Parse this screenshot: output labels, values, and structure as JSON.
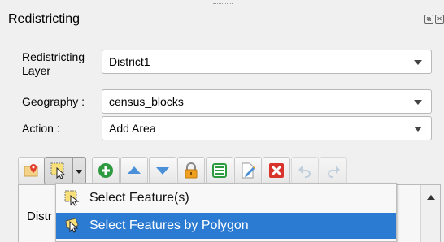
{
  "panel": {
    "title": "Redistricting",
    "window_buttons": [
      {
        "icon": "float-icon",
        "glyph": "⧉"
      },
      {
        "icon": "close-icon",
        "glyph": "✕"
      }
    ]
  },
  "form": {
    "layer": {
      "label_line1": "Redistricting",
      "label_line2": "Layer",
      "value": "District1"
    },
    "geography": {
      "label": "Geography :",
      "value": "census_blocks"
    },
    "action": {
      "label": "Action :",
      "value": "Add Area"
    }
  },
  "toolbar": {
    "buttons": [
      {
        "name": "map-pin-button",
        "icon": "map-pin-icon",
        "enabled": true
      },
      {
        "name": "select-tool-button",
        "icon": "select-feature-icon",
        "enabled": true,
        "pressed": true
      },
      {
        "name": "add-button",
        "icon": "plus-circle-icon",
        "enabled": true
      },
      {
        "name": "move-up-button",
        "icon": "arrow-up-icon",
        "enabled": true
      },
      {
        "name": "move-down-button",
        "icon": "arrow-down-icon",
        "enabled": true
      },
      {
        "name": "lock-button",
        "icon": "lock-icon",
        "enabled": true
      },
      {
        "name": "attribute-table-button",
        "icon": "table-icon",
        "enabled": true
      },
      {
        "name": "edit-button",
        "icon": "edit-document-icon",
        "enabled": true
      },
      {
        "name": "delete-button",
        "icon": "delete-icon",
        "enabled": true
      },
      {
        "name": "undo-button",
        "icon": "undo-icon",
        "enabled": false
      },
      {
        "name": "redo-button",
        "icon": "redo-icon",
        "enabled": false
      }
    ]
  },
  "table": {
    "header_partial": "Distr"
  },
  "dropdown_menu": {
    "items": [
      {
        "label": "Select Feature(s)",
        "icon": "select-feature-icon",
        "highlighted": false
      },
      {
        "label": "Select Features by Polygon",
        "icon": "select-polygon-icon",
        "highlighted": true
      }
    ]
  },
  "colors": {
    "highlight": "#2b7bd3",
    "green": "#2e9a3f",
    "blue_arrow": "#4a90d9",
    "lock_orange": "#f0a020",
    "delete_red": "#d9342b"
  }
}
